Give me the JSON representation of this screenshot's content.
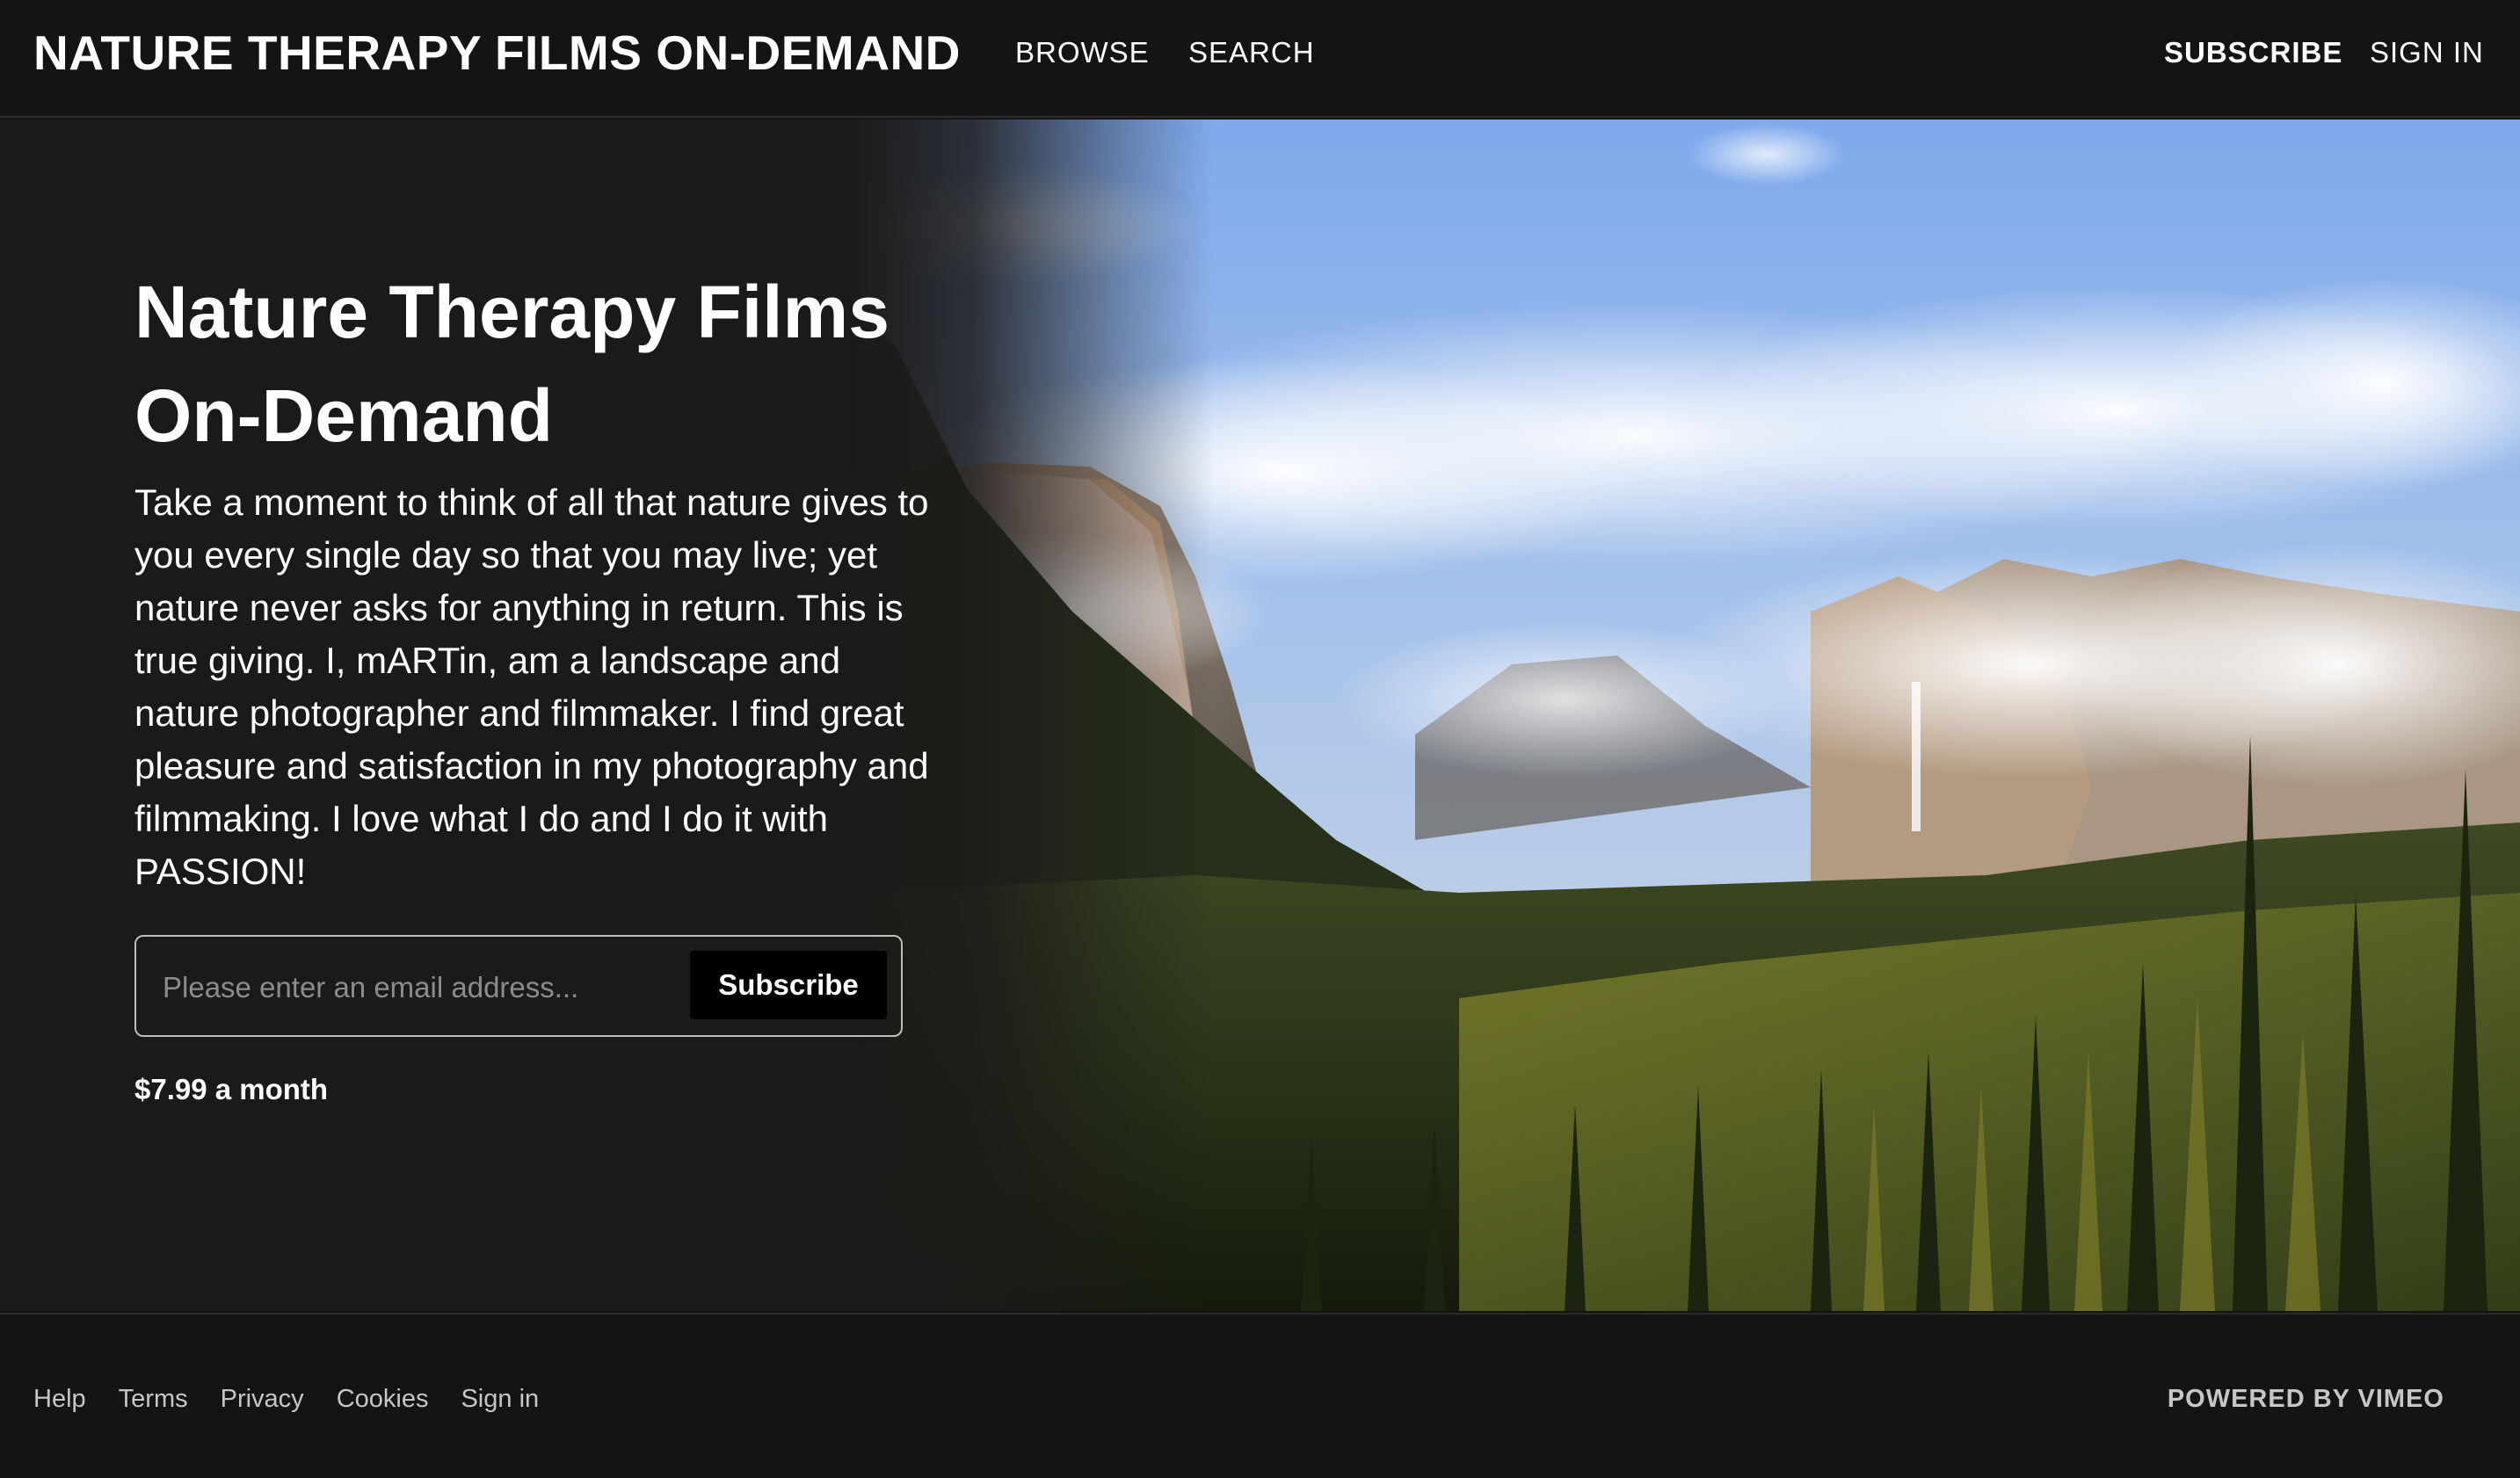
{
  "header": {
    "brand": "NATURE THERAPY FILMS ON-DEMAND",
    "nav": {
      "browse": "BROWSE",
      "search": "SEARCH",
      "subscribe": "SUBSCRIBE",
      "sign_in": "SIGN IN"
    }
  },
  "hero": {
    "title": "Nature Therapy Films On-Demand",
    "description": "Take a moment to think of all that nature gives to you every single day so that you may live; yet nature never asks for anything in return. This is true giving. I, mARTin, am a landscape and nature photographer and filmmaker. I find great pleasure and satisfaction in my photography and filmmaking. I love what I do and I do it with PASSION!",
    "email_placeholder": "Please enter an email address...",
    "email_value": "",
    "subscribe_button": "Subscribe",
    "price": "$7.99 a month"
  },
  "footer": {
    "links": [
      "Help",
      "Terms",
      "Privacy",
      "Cookies",
      "Sign in"
    ],
    "powered_by": "POWERED BY VIMEO"
  },
  "colors": {
    "background": "#141414",
    "hero_background": "#1b1a19",
    "text": "#ffffff",
    "muted_text": "#c6c6c6",
    "button_background": "#000000"
  }
}
